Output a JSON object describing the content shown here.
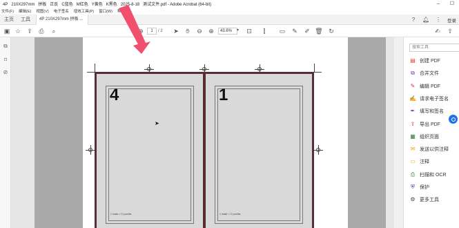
{
  "titlebar": {
    "items": [
      "4P",
      "210X297mm",
      "拼板",
      "正反",
      "C蓝色",
      "M红色",
      "Y黄色",
      "K黑色",
      "2025-8-18",
      "测试文件.pdf - Adobe Acrobat (64-bit)"
    ]
  },
  "menubar": {
    "items": [
      "文件(F)",
      "编辑(E)",
      "视图(V)",
      "电子签名",
      "窗口(W)",
      "帮助(H)"
    ],
    "extra": "增效工具(P)"
  },
  "tabs": {
    "home": "主页",
    "tools": "工具",
    "doc": "4P 210X297mm 拼板 ...",
    "close": "×"
  },
  "topbar": {
    "help_icon": "help-icon",
    "bell_icon": "bell-icon",
    "login": "登录"
  },
  "toolbar": {
    "page_current": "1",
    "page_total": "/ 2",
    "zoom": "43.6%"
  },
  "document": {
    "left_panel_number": "4",
    "right_panel_number": "1",
    "footer_text": "1 lmate • 72 pcmlits"
  },
  "rightpanel": {
    "search_placeholder": "搜索工具",
    "tools": [
      {
        "label": "创建 PDF",
        "icon": "create-pdf-icon",
        "color": "#e03a2f"
      },
      {
        "label": "合并文件",
        "icon": "combine-files-icon",
        "color": "#7b2cbf"
      },
      {
        "label": "编辑 PDF",
        "icon": "edit-pdf-icon",
        "color": "#d81b60"
      },
      {
        "label": "请求电子签名",
        "icon": "request-signature-icon",
        "color": "#7b2cbf"
      },
      {
        "label": "填写和签名",
        "icon": "fill-sign-icon",
        "color": "#7b2cbf"
      },
      {
        "label": "导出 PDF",
        "icon": "export-pdf-icon",
        "color": "#e03a2f"
      },
      {
        "label": "组织页面",
        "icon": "organize-pages-icon",
        "color": "#2e7d32"
      },
      {
        "label": "发送以供注释",
        "icon": "send-comment-icon",
        "color": "#f4a300"
      },
      {
        "label": "注释",
        "icon": "comment-icon",
        "color": "#f4a300"
      },
      {
        "label": "扫描和 OCR",
        "icon": "scan-ocr-icon",
        "color": "#2e7d32"
      },
      {
        "label": "保护",
        "icon": "protect-icon",
        "color": "#3949ab"
      },
      {
        "label": "更多工具",
        "icon": "more-tools-icon",
        "color": "#444444"
      }
    ]
  },
  "colors": {
    "sheet_border": "#5a2d34",
    "arrow": "#f0506e",
    "accent": "#1a73e8"
  }
}
